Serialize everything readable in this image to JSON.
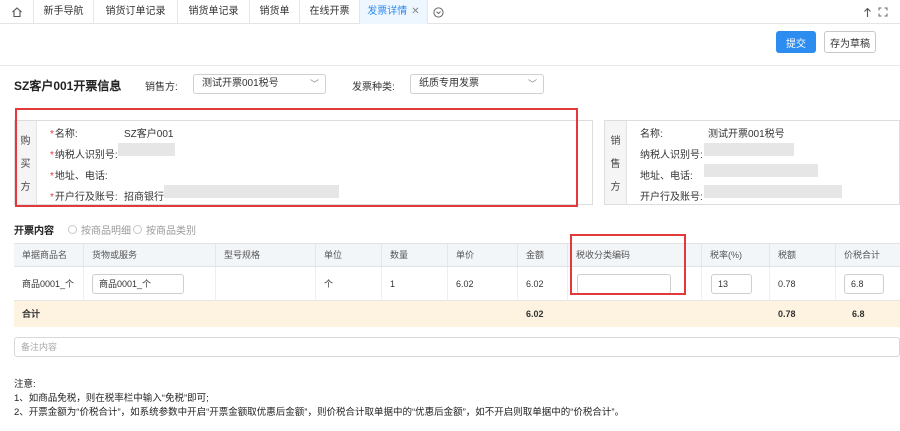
{
  "tabs": [
    {
      "label": "新手导航"
    },
    {
      "label": "销货订单记录"
    },
    {
      "label": "销货单记录"
    },
    {
      "label": "销货单"
    },
    {
      "label": "在线开票"
    },
    {
      "label": "发票详情",
      "close": "✕"
    }
  ],
  "actions": {
    "submit": "提交",
    "save_draft": "存为草稿"
  },
  "header": {
    "title": "SZ客户001开票信息",
    "seller_label": "销售方:",
    "seller_value": "测试开票001税号",
    "invoice_type_label": "发票种类:",
    "invoice_type_value": "纸质专用发票"
  },
  "buyer": {
    "side_label": [
      "购",
      "买",
      "方"
    ],
    "required_mark": "*",
    "name_label": "名称:",
    "name_value": "SZ客户001",
    "tax_id_label": "纳税人识别号:",
    "address_label": "地址、电话:",
    "bank_label": "开户行及账号:",
    "bank_value": "招商银行"
  },
  "seller": {
    "side_label": [
      "销",
      "售",
      "方"
    ],
    "name_label": "名称:",
    "name_value": "测试开票001税号",
    "tax_id_label": "纳税人识别号:",
    "address_label": "地址、电话:",
    "bank_label": "开户行及账号:"
  },
  "content": {
    "title": "开票内容",
    "radio_by_detail": "按商品明细",
    "radio_by_category": "按商品类别"
  },
  "table": {
    "columns": [
      "单据商品名",
      "货物或服务",
      "型号规格",
      "单位",
      "数量",
      "单价",
      "金额",
      "税收分类编码",
      "税率(%)",
      "税额",
      "价税合计"
    ],
    "row": {
      "doc_item_name": "商品0001_个",
      "goods_service": "商品0001_个",
      "model": "",
      "unit": "个",
      "qty": "1",
      "unit_price": "6.02",
      "amount": "6.02",
      "tax_code": "",
      "tax_rate": "13",
      "tax_amount": "0.78",
      "total": "6.8"
    },
    "summary": {
      "label": "合计",
      "amount": "6.02",
      "tax_amount": "0.78",
      "total": "6.8"
    }
  },
  "remark_placeholder": "备注内容",
  "notes": {
    "title": "注意:",
    "line1": "1、如商品免税，则在税率栏中输入“免税”即可;",
    "line2": "2、开票金额为“价税合计”，如系统参数中开启“开票金额取优惠后金额”，则价税合计取单据中的“优惠后金额”，如不开启则取单据中的“价税合计”。"
  },
  "highlight_color": "#e4393c",
  "accent_color": "#2d8cf0"
}
